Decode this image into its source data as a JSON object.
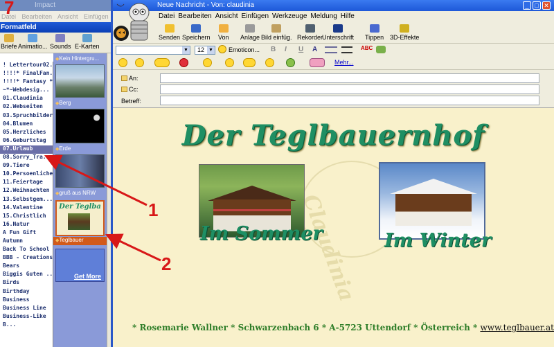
{
  "step_label": "7",
  "back_window": {
    "title": "Impact",
    "menu": "Datei Bearbeiten Ansicht Einfügen Format",
    "caption": "Formatfeld",
    "tools": [
      "Briefe",
      "Animatio...",
      "Sounds",
      "E-Karten"
    ],
    "list_items": [
      "! Lettertour02...",
      "!!!!* FinalFan...",
      "!!!!* Fantasy *...",
      "~*~Webdesig...",
      "01.Claudinia",
      "02.Webseiten",
      "03.Spruchbilder",
      "04.Blumen",
      "05.Herzliches",
      "06.Geburtstag",
      "07.Urlaub",
      "08.Sorry_Tra...",
      "09.Tiere",
      "10.Persoenliche",
      "11.Feiertage",
      "12.Weihnachten",
      "13.Selbstgem...",
      "14.Valentine",
      "15.Christlich",
      "16.Natur",
      "A Fun Gift",
      "Autumn",
      "Back To School",
      "BBB - Creations",
      "Bears",
      "Biggis Guten ...",
      "Birds",
      "Birthday",
      "Business",
      "Business Line",
      "Business-Like",
      "B..."
    ],
    "selected_index": 10,
    "thumbnails": [
      "Kein Hintergru...",
      "Berg",
      "Erde",
      "gruß aus NRW",
      "Teglbauer"
    ],
    "thumb_teglbauer_text": "Der Teglba",
    "get_more": "Get More"
  },
  "main_window": {
    "title": "Neue Nachricht - Von: claudinia",
    "window_buttons": [
      "_",
      "□",
      "✕"
    ],
    "menu": [
      "Datei",
      "Bearbeiten",
      "Ansicht",
      "Einfügen",
      "Werkzeuge",
      "Meldung",
      "Hilfe"
    ],
    "toolbar": [
      "Senden",
      "Speichern",
      "Von",
      "Anlage",
      "Bild einfüg.",
      "Rekorder",
      "Unterschrift",
      "Tippen",
      "3D-Effekte"
    ],
    "font_size": "12",
    "emoticon_label": "Emoticon...",
    "format_buttons": [
      "B",
      "I",
      "U",
      "A"
    ],
    "more_link": "Mehr...",
    "fields": {
      "to": "An:",
      "cc": "Cc:",
      "subject": "Betreff:"
    }
  },
  "stationery": {
    "heading": "Der Teglbauernhof",
    "caption_summer": "Im Sommer",
    "caption_winter": "Im Winter",
    "watermark": "Claudinia",
    "footer_text": "* Rosemarie Wallner * Schwarzenbach 6 * A-5723 Uttendorf *  Österreich * ",
    "footer_link": "www.teglbauer.at"
  },
  "annotations": [
    "1",
    "2"
  ],
  "colors": {
    "accent": "#1f8f63",
    "title_bar": "#1d58d8",
    "annotation": "#d81818"
  }
}
